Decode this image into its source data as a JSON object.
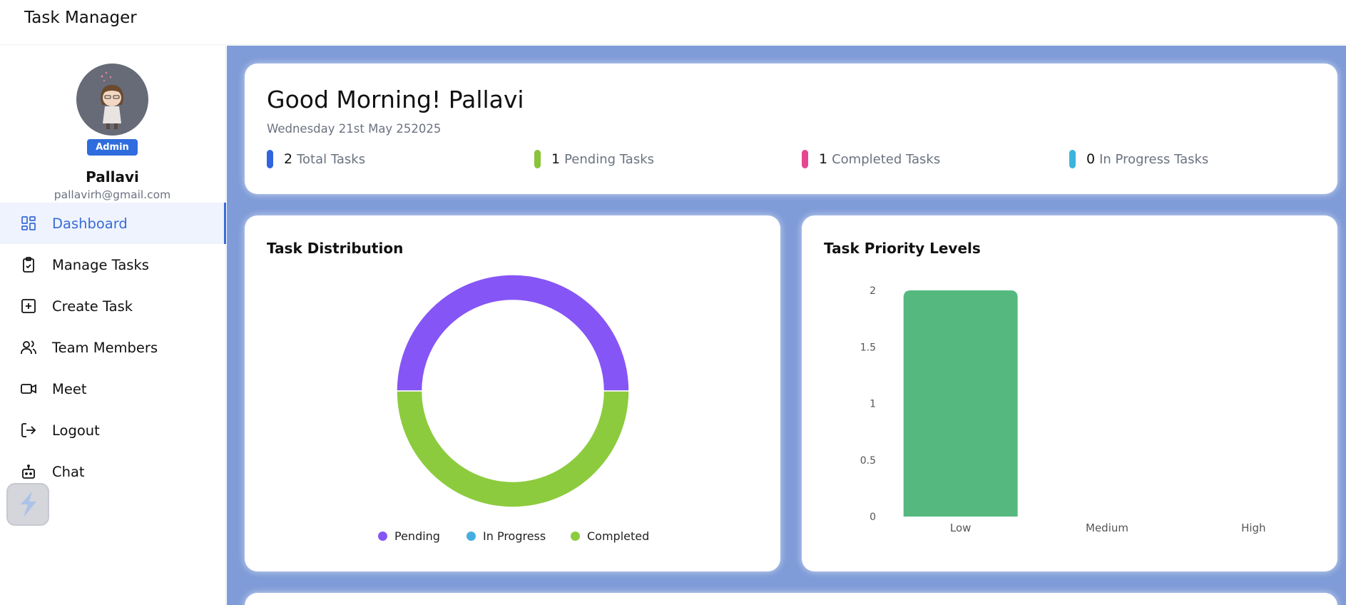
{
  "app": {
    "title": "Task Manager"
  },
  "user": {
    "role": "Admin",
    "name": "Pallavi",
    "email": "pallavirh@gmail.com"
  },
  "nav": [
    {
      "label": "Dashboard",
      "icon": "dashboard-icon",
      "active": true
    },
    {
      "label": "Manage Tasks",
      "icon": "clipboard-check-icon",
      "active": false
    },
    {
      "label": "Create Task",
      "icon": "plus-square-icon",
      "active": false
    },
    {
      "label": "Team Members",
      "icon": "users-icon",
      "active": false
    },
    {
      "label": "Meet",
      "icon": "video-icon",
      "active": false
    },
    {
      "label": "Logout",
      "icon": "logout-icon",
      "active": false
    },
    {
      "label": "Chat",
      "icon": "bot-icon",
      "active": false
    }
  ],
  "greeting": {
    "title": "Good Morning! Pallavi",
    "date": "Wednesday 21st May 252025"
  },
  "stats": [
    {
      "count": "2",
      "label": "Total Tasks",
      "color": "#3065e0"
    },
    {
      "count": "1",
      "label": "Pending Tasks",
      "color": "#8ac43a"
    },
    {
      "count": "1",
      "label": "Completed Tasks",
      "color": "#e64691"
    },
    {
      "count": "0",
      "label": "In Progress Tasks",
      "color": "#3cb4dc"
    }
  ],
  "colors": {
    "main_background": "#7f9cd8",
    "accent": "#3b6bd8",
    "badge": "#2f6cdd"
  },
  "chart_data": [
    {
      "type": "pie",
      "title": "Task Distribution",
      "donut": true,
      "categories": [
        "Pending",
        "In Progress",
        "Completed"
      ],
      "values": [
        1,
        0,
        1
      ],
      "colors": [
        "#8655f6",
        "#45aee0",
        "#8ccb3e"
      ],
      "legend": "bottom"
    },
    {
      "type": "bar",
      "title": "Task Priority Levels",
      "categories": [
        "Low",
        "Medium",
        "High"
      ],
      "values": [
        2,
        0,
        0
      ],
      "color": "#55b97f",
      "ylim": [
        0,
        2
      ],
      "yticks": [
        "0",
        "0.5",
        "1",
        "1.5",
        "2"
      ],
      "grid": false
    }
  ]
}
